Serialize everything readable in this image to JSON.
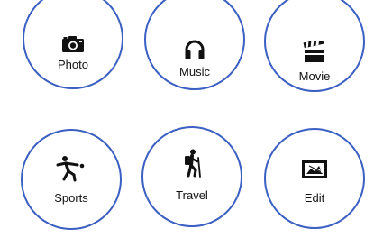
{
  "tiles": [
    {
      "label": "Photo",
      "icon": "camera-icon"
    },
    {
      "label": "Music",
      "icon": "headphones-icon"
    },
    {
      "label": "Movie",
      "icon": "clapperboard-icon"
    },
    {
      "label": "Sports",
      "icon": "cricket-player-icon"
    },
    {
      "label": "Travel",
      "icon": "hiker-icon"
    },
    {
      "label": "Edit",
      "icon": "edit-image-icon"
    }
  ],
  "colors": {
    "circle_border": "#3b5fc2",
    "icon": "#111111",
    "background": "#ffffff"
  }
}
